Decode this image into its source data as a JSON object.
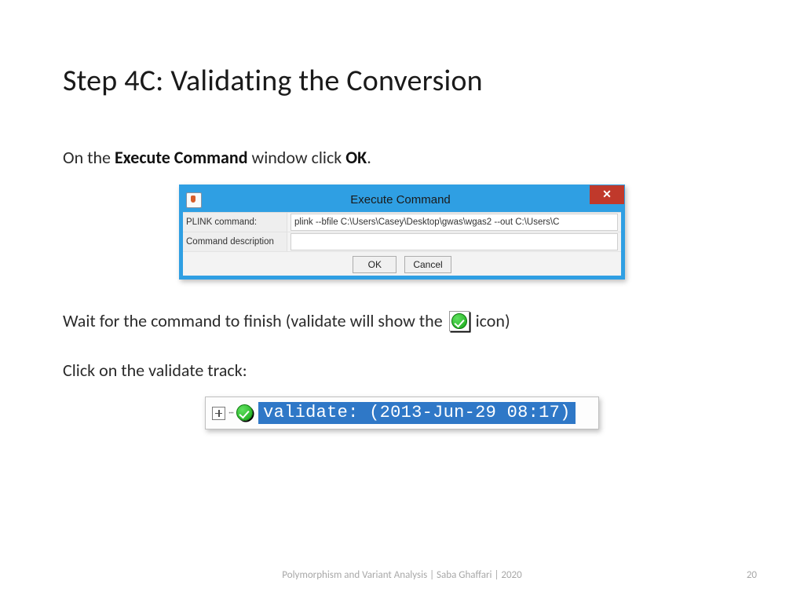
{
  "title": "Step 4C: Validating the Conversion",
  "body": {
    "line1_pre": "On the ",
    "line1_bold1": "Execute Command",
    "line1_mid": " window click ",
    "line1_bold2": "OK",
    "line1_post": ".",
    "line2_pre": "Wait for the command to finish (validate will show the ",
    "line2_post": " icon)",
    "line3": "Click on the validate track:"
  },
  "execWindow": {
    "title": "Execute Command",
    "closeGlyph": "✕",
    "row1_label": "PLINK command:",
    "row1_value": "plink   --bfile C:\\Users\\Casey\\Desktop\\gwas\\wgas2  --out C:\\Users\\C",
    "row2_label": "Command description",
    "row2_value": "",
    "ok": "OK",
    "cancel": "Cancel"
  },
  "track": {
    "label": "validate: (2013-Jun-29 08:17)"
  },
  "footer": "Polymorphism and Variant Analysis | Saba Ghaffari | 2020",
  "pageNumber": "20"
}
